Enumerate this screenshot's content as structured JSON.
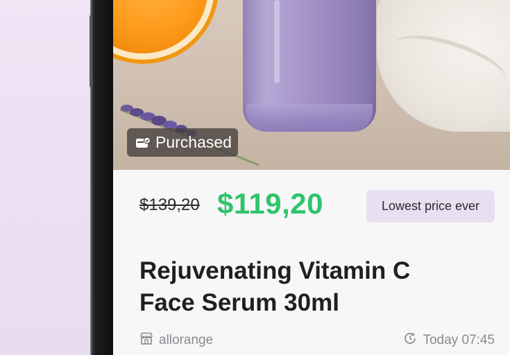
{
  "product": {
    "badge_purchased": "Purchased",
    "old_price": "$139,20",
    "new_price": "$119,20",
    "price_badge": "Lowest price ever",
    "title_line1": "Rejuvenating Vitamin C",
    "title_line2": "Face Serum 30ml",
    "seller": "allorange",
    "time": "Today 07:45"
  },
  "icons": {
    "purchased": "wallet-check-icon",
    "seller": "store-icon",
    "time": "clock-icon"
  },
  "colors": {
    "price_accent": "#2fc46b",
    "badge_bg": "#e8e0f0",
    "muted_text": "#8a8a90"
  }
}
